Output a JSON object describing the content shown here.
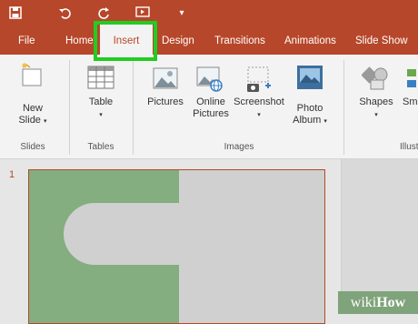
{
  "tabs": {
    "file": "File",
    "home": "Home",
    "insert": "Insert",
    "design": "Design",
    "transitions": "Transitions",
    "animations": "Animations",
    "slideshow": "Slide Show"
  },
  "ribbon": {
    "new_slide_line1": "New",
    "new_slide_line2": "Slide",
    "table": "Table",
    "pictures": "Pictures",
    "online_pictures_line1": "Online",
    "online_pictures_line2": "Pictures",
    "screenshot": "Screenshot",
    "photo_album_line1": "Photo",
    "photo_album_line2": "Album",
    "shapes": "Shapes",
    "smartart_partial": "Sma",
    "groups": {
      "slides": "Slides",
      "tables": "Tables",
      "images": "Images",
      "illustrations_partial": "Illustr"
    }
  },
  "thumbnail": {
    "number": "1"
  },
  "watermark": {
    "prefix": "wiki",
    "suffix": "How"
  },
  "colors": {
    "accent": "#b7472a",
    "highlight": "#22cc22",
    "ribbon_bg": "#f3f3f3",
    "slide_green": "#84ad80"
  }
}
